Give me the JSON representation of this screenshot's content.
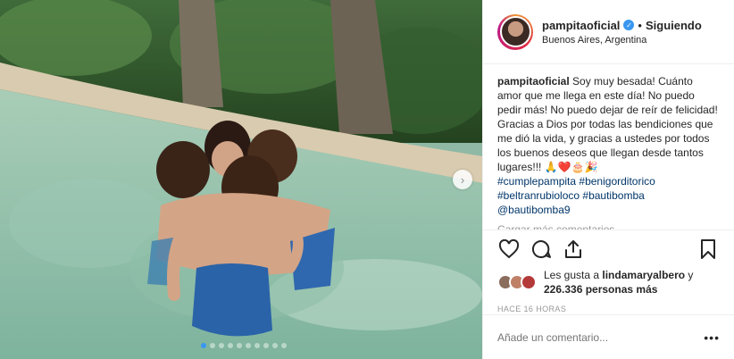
{
  "header": {
    "username": "pampitaoficial",
    "separator": "•",
    "follow_status": "Siguiendo",
    "location": "Buenos Aires, Argentina"
  },
  "caption": {
    "username": "pampitaoficial",
    "text": " Soy muy besada! Cuánto amor que me llega en este día! No puedo pedir más! No puedo dejar de reír de felicidad! Gracias a Dios por todas las bendiciones que me dió la vida, y gracias a ustedes por todos los buenos deseos que llegan desde tantos lugares!!! 🙏❤️🎂🎉",
    "hashtags": [
      "#cumplepampita",
      "#benigorditorico",
      "#beltranrubioloco",
      "#bautibomba"
    ],
    "mention": "@bautibomba9",
    "load_more": "Cargar más comentarios"
  },
  "actions": {
    "icons": [
      "heart-icon",
      "comment-icon",
      "share-icon",
      "bookmark-icon"
    ]
  },
  "likes": {
    "prefix": "Les gusta a ",
    "first_user": "lindamaryalbero",
    "joiner": " y",
    "count": "226.336 personas más"
  },
  "timestamp": "HACE 16 HORAS",
  "comment": {
    "placeholder": "Añade un comentario...",
    "options": "•••"
  },
  "carousel": {
    "total_slides": 10,
    "active_index": 0,
    "next_label": "›"
  },
  "colors": {
    "link": "#003569",
    "accent_blue": "#3897f0",
    "like_red": "#ed4956",
    "muted": "#999999"
  }
}
